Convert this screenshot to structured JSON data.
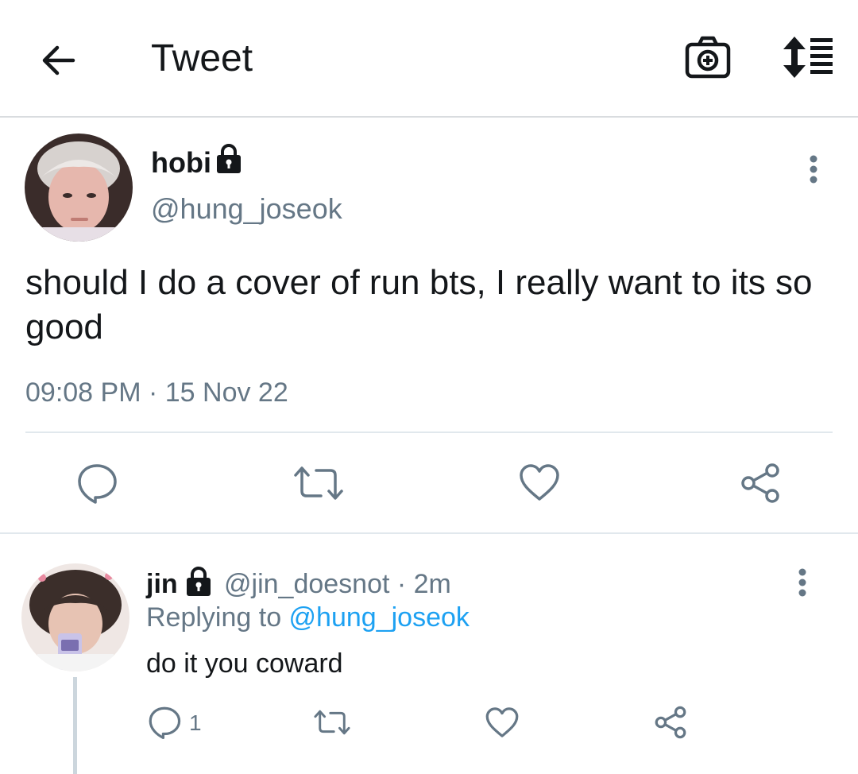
{
  "header": {
    "title": "Tweet"
  },
  "tweet": {
    "author_name": "hobi",
    "author_handle": "@hung_joseok",
    "text": "should I do a cover of run bts, I really want to its so good",
    "timestamp": "09:08 PM · 15 Nov 22",
    "protected": true
  },
  "reply": {
    "author_name": "jin",
    "meta": "@jin_doesnot · 2m",
    "replying_prefix": "Replying to ",
    "replying_to": "@hung_joseok",
    "text": "do it you coward",
    "reply_count": "1",
    "protected": true
  },
  "icons": {
    "back": "arrow-left-icon",
    "camera": "camera-plus-icon",
    "sort": "sort-lines-icon",
    "lock": "lock-icon",
    "more": "more-vertical-icon",
    "reply": "chat-bubble-icon",
    "retweet": "retweet-icon",
    "like": "heart-icon",
    "share": "share-icon"
  },
  "colors": {
    "text": "#14171a",
    "secondary": "#657786",
    "link": "#1da1f2",
    "divider": "#e1e8ed"
  }
}
